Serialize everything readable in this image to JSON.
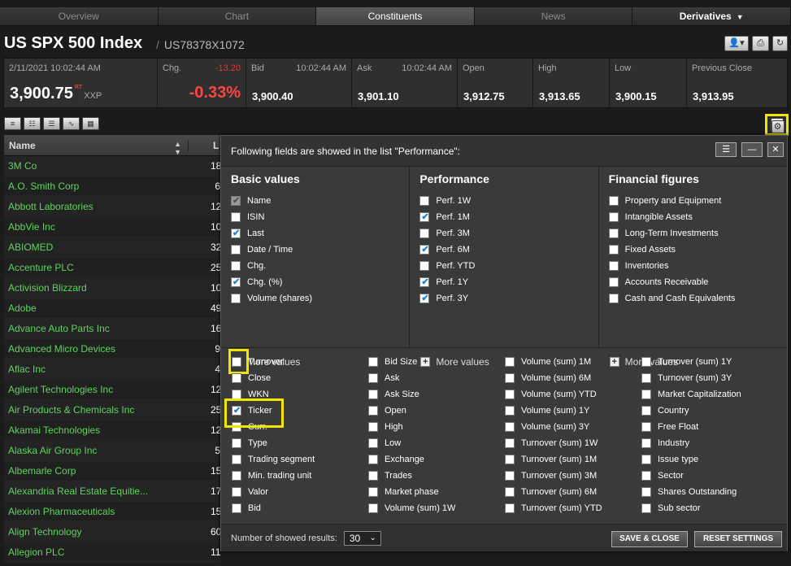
{
  "tabs": [
    "Overview",
    "Chart",
    "Constituents",
    "News",
    "Derivatives"
  ],
  "instrument": {
    "name": "US SPX 500 Index",
    "isin": "US78378X1072"
  },
  "quote": {
    "datetime": "2/11/2021 10:02:44 AM",
    "last": "3,900.75",
    "rt": "RT",
    "market": "XXP",
    "chg_label": "Chg.",
    "chg_abs": "-13.20",
    "chg_pct": "-0.33%",
    "bid_label": "Bid",
    "bid_time": "10:02:44 AM",
    "bid": "3,900.40",
    "ask_label": "Ask",
    "ask_time": "10:02:44 AM",
    "ask": "3,901.10",
    "open_label": "Open",
    "open": "3,912.75",
    "high_label": "High",
    "high": "3,913.65",
    "low_label": "Low",
    "low": "3,900.15",
    "prev_label": "Previous Close",
    "prev": "3,913.95"
  },
  "list": {
    "col_name": "Name",
    "col_last": "L",
    "rows": [
      {
        "name": "3M Co",
        "last": "18"
      },
      {
        "name": "A.O. Smith Corp",
        "last": "6"
      },
      {
        "name": "Abbott Laboratories",
        "last": "12"
      },
      {
        "name": "AbbVie Inc",
        "last": "10"
      },
      {
        "name": "ABIOMED",
        "last": "32"
      },
      {
        "name": "Accenture PLC",
        "last": "25"
      },
      {
        "name": "Activision Blizzard",
        "last": "10"
      },
      {
        "name": "Adobe",
        "last": "49"
      },
      {
        "name": "Advance Auto Parts Inc",
        "last": "16"
      },
      {
        "name": "Advanced Micro Devices",
        "last": "9"
      },
      {
        "name": "Aflac Inc",
        "last": "4"
      },
      {
        "name": "Agilent Technologies Inc",
        "last": "12"
      },
      {
        "name": "Air Products & Chemicals Inc",
        "last": "25"
      },
      {
        "name": "Akamai Technologies",
        "last": "12"
      },
      {
        "name": "Alaska Air Group Inc",
        "last": "5"
      },
      {
        "name": "Albemarle Corp",
        "last": "15"
      },
      {
        "name": "Alexandria Real Estate Equitie...",
        "last": "17"
      },
      {
        "name": "Alexion Pharmaceuticals",
        "last": "15"
      },
      {
        "name": "Align Technology",
        "last": "60"
      },
      {
        "name": "Allegion PLC",
        "last": "11"
      }
    ]
  },
  "panel": {
    "header": "Following fields are showed in the list \"Performance\":",
    "basic": {
      "title": "Basic values",
      "items": [
        {
          "label": "Name",
          "checked": true,
          "disabled": true
        },
        {
          "label": "ISIN",
          "checked": false
        },
        {
          "label": "Last",
          "checked": true
        },
        {
          "label": "Date / Time",
          "checked": false
        },
        {
          "label": "Chg.",
          "checked": false
        },
        {
          "label": "Chg. (%)",
          "checked": true
        },
        {
          "label": "Volume (shares)",
          "checked": false
        }
      ]
    },
    "performance": {
      "title": "Performance",
      "items": [
        {
          "label": "Perf. 1W",
          "checked": false
        },
        {
          "label": "Perf. 1M",
          "checked": true
        },
        {
          "label": "Perf. 3M",
          "checked": false
        },
        {
          "label": "Perf. 6M",
          "checked": true
        },
        {
          "label": "Perf. YTD",
          "checked": false
        },
        {
          "label": "Perf. 1Y",
          "checked": true
        },
        {
          "label": "Perf. 3Y",
          "checked": true
        }
      ]
    },
    "financial": {
      "title": "Financial figures",
      "items": [
        {
          "label": "Property and Equipment",
          "checked": false
        },
        {
          "label": "Intangible Assets",
          "checked": false
        },
        {
          "label": "Long-Term Investments",
          "checked": false
        },
        {
          "label": "Fixed Assets",
          "checked": false
        },
        {
          "label": "Inventories",
          "checked": false
        },
        {
          "label": "Accounts Receivable",
          "checked": false
        },
        {
          "label": "Cash and Cash Equivalents",
          "checked": false
        }
      ]
    },
    "more_label": "More values",
    "extra": [
      {
        "label": "Turnover",
        "checked": false
      },
      {
        "label": "Close",
        "checked": false
      },
      {
        "label": "WKN",
        "checked": false
      },
      {
        "label": "Ticker",
        "checked": true
      },
      {
        "label": "Curr.",
        "checked": false
      },
      {
        "label": "Type",
        "checked": false
      },
      {
        "label": "Trading segment",
        "checked": false
      },
      {
        "label": "Min. trading unit",
        "checked": false
      },
      {
        "label": "Valor",
        "checked": false
      },
      {
        "label": "Bid",
        "checked": false
      },
      {
        "label": "Bid Size",
        "checked": false
      },
      {
        "label": "Ask",
        "checked": false
      },
      {
        "label": "Ask Size",
        "checked": false
      },
      {
        "label": "Open",
        "checked": false
      },
      {
        "label": "High",
        "checked": false
      },
      {
        "label": "Low",
        "checked": false
      },
      {
        "label": "Exchange",
        "checked": false
      },
      {
        "label": "Trades",
        "checked": false
      },
      {
        "label": "Market phase",
        "checked": false
      },
      {
        "label": "Volume (sum) 1W",
        "checked": false
      },
      {
        "label": "Volume (sum) 1M",
        "checked": false
      },
      {
        "label": "Volume (sum) 6M",
        "checked": false
      },
      {
        "label": "Volume (sum) YTD",
        "checked": false
      },
      {
        "label": "Volume (sum) 1Y",
        "checked": false
      },
      {
        "label": "Volume (sum) 3Y",
        "checked": false
      },
      {
        "label": "Turnover (sum) 1W",
        "checked": false
      },
      {
        "label": "Turnover (sum) 1M",
        "checked": false
      },
      {
        "label": "Turnover (sum) 3M",
        "checked": false
      },
      {
        "label": "Turnover (sum) 6M",
        "checked": false
      },
      {
        "label": "Turnover (sum) YTD",
        "checked": false
      },
      {
        "label": "Turnover (sum) 1Y",
        "checked": false
      },
      {
        "label": "Turnover (sum) 3Y",
        "checked": false
      },
      {
        "label": "Market Capitalization",
        "checked": false
      },
      {
        "label": "Country",
        "checked": false
      },
      {
        "label": "Free Float",
        "checked": false
      },
      {
        "label": "Industry",
        "checked": false
      },
      {
        "label": "Issue type",
        "checked": false
      },
      {
        "label": "Sector",
        "checked": false
      },
      {
        "label": "Shares Outstanding",
        "checked": false
      },
      {
        "label": "Sub sector",
        "checked": false
      }
    ],
    "results_label": "Number of showed results:",
    "results_value": "30",
    "save_label": "SAVE & CLOSE",
    "reset_label": "RESET SETTINGS"
  },
  "colors": {
    "highlight": "#f2e600",
    "positive_name": "#5ed45e",
    "negative": "#e33",
    "check": "#1e7fd6"
  }
}
